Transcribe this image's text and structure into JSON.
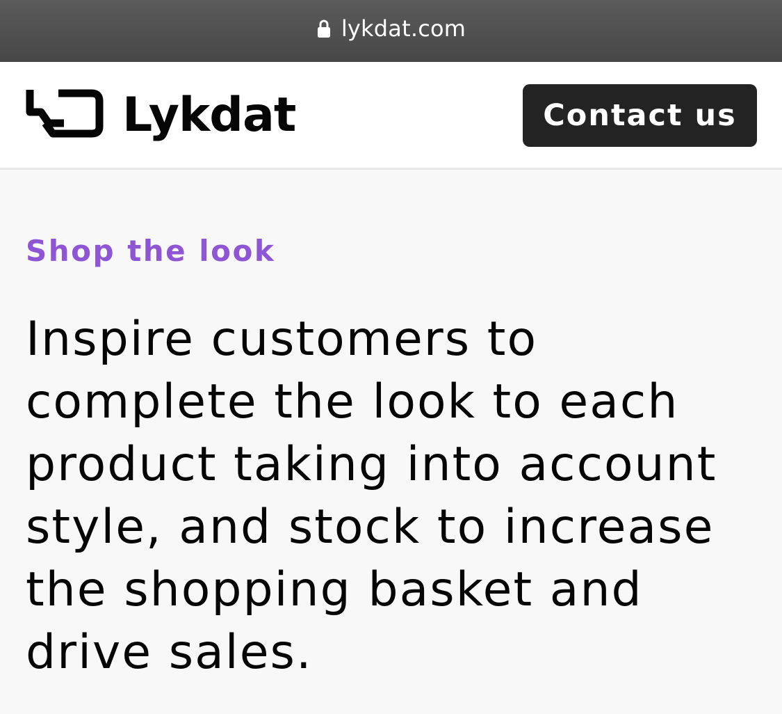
{
  "browser": {
    "url": "lykdat.com",
    "lock_icon": "lock-icon"
  },
  "header": {
    "brand_name": "Lykdat",
    "logo_icon": "lykdat-logo-mark-icon",
    "contact_button_label": "Contact us"
  },
  "hero": {
    "eyebrow": "Shop the look",
    "headline": "Inspire customers to complete the look to each product taking into account style, and stock to increase the shopping basket and drive sales."
  },
  "colors": {
    "accent": "#8e55d4",
    "button_bg": "#232323",
    "url_bar_bg": "#4f4f4f",
    "page_bg": "#f8f8f8"
  }
}
